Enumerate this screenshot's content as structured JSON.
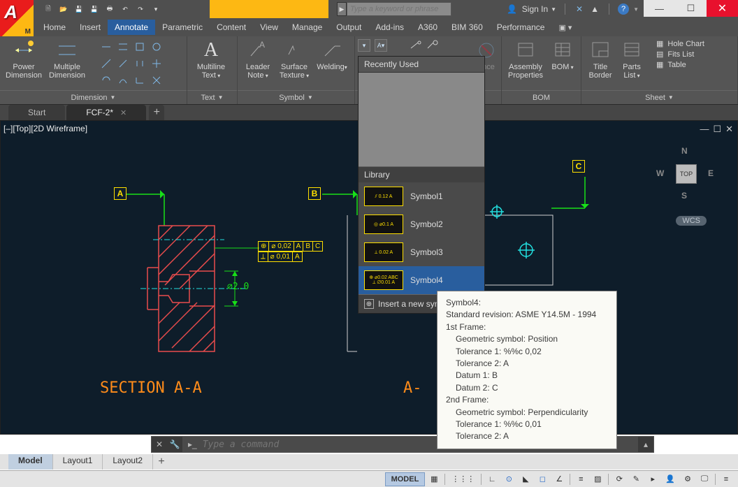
{
  "filename": "FCF-2.dwg",
  "search": {
    "placeholder": "Type a keyword or phrase"
  },
  "titlebar_right": {
    "signin": "Sign In"
  },
  "menu": {
    "tabs": [
      "Home",
      "Insert",
      "Annotate",
      "Parametric",
      "Content",
      "View",
      "Manage",
      "Output",
      "Add-ins",
      "A360",
      "BIM 360",
      "Performance"
    ],
    "active_index": 2
  },
  "ribbon": {
    "dimension": {
      "power": "Power Dimension",
      "multiple": "Multiple Dimension",
      "title": "Dimension"
    },
    "text": {
      "multiline": "Multiline Text",
      "title": "Text"
    },
    "symbol": {
      "leader": "Leader Note",
      "surface": "Surface Texture",
      "welding": "Welding",
      "title": "Symbol"
    },
    "right_panels": {
      "insert": "ence",
      "assembly": "Assembly Properties",
      "bom": "BOM",
      "bom_title": "BOM",
      "title_border": "Title Border",
      "parts_list": "Parts List",
      "hole_chart": "Hole Chart",
      "fits_list": "Fits List",
      "table": "Table",
      "sheet_title": "Sheet"
    }
  },
  "dropdown": {
    "recent_header": "Recently Used",
    "library_header": "Library",
    "items": [
      {
        "label": "Symbol1",
        "thumb": "⫽ 0.12 A"
      },
      {
        "label": "Symbol2",
        "thumb": "◎ ⌀0.1 A"
      },
      {
        "label": "Symbol3",
        "thumb": "⟂ 0.02 A"
      },
      {
        "label": "Symbol4",
        "thumb": "⊕ ⌀0.02 ABC\n⟂ ⌀0.01 A"
      }
    ],
    "footer": "Insert a new sym"
  },
  "tooltip": {
    "title": "Symbol4:",
    "lines": [
      {
        "t": "Standard revision: ASME Y14.5M - 1994",
        "i": 0
      },
      {
        "t": "1st Frame:",
        "i": 0
      },
      {
        "t": "Geometric symbol: Position",
        "i": 1
      },
      {
        "t": "Tolerance 1: %%c 0,02",
        "i": 1
      },
      {
        "t": "Tolerance 2: A",
        "i": 1
      },
      {
        "t": "Datum 1: B",
        "i": 1
      },
      {
        "t": "Datum 2: C",
        "i": 1
      },
      {
        "t": "2nd Frame:",
        "i": 0
      },
      {
        "t": "Geometric symbol: Perpendicularity",
        "i": 1
      },
      {
        "t": "Tolerance 1: %%c 0,01",
        "i": 1
      },
      {
        "t": "Tolerance 2: A",
        "i": 1
      }
    ]
  },
  "doctabs": {
    "tabs": [
      "Start",
      "FCF-2*"
    ],
    "active_index": 1
  },
  "canvas": {
    "corner": "[–][Top][2D Wireframe]",
    "viewcube": {
      "top": "TOP",
      "n": "N",
      "s": "S",
      "e": "E",
      "w": "W"
    },
    "wcs": "WCS",
    "datums": {
      "a": "A",
      "b": "B",
      "c": "C"
    },
    "dim_diameter": "⌀2.0",
    "fcf": {
      "row1": [
        "⊕",
        "⌀ 0,02",
        "A",
        "B",
        "C"
      ],
      "row2": [
        "⟂",
        "⌀ 0,01",
        "A"
      ]
    },
    "section_a": "SECTION A-A",
    "section_a_right": "A-"
  },
  "cmdline": {
    "placeholder": "Type a command"
  },
  "layout": {
    "tabs": [
      "Model",
      "Layout1",
      "Layout2"
    ],
    "active_index": 0
  },
  "status": {
    "model": "MODEL"
  }
}
